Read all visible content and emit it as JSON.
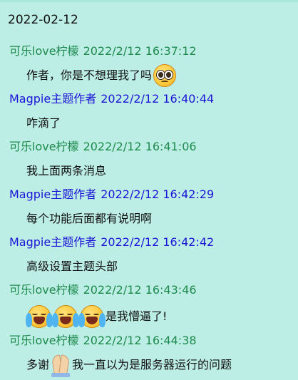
{
  "date_header": "2022-02-12",
  "colors": {
    "background": "#bdeee6",
    "sender_green": "#1d8a4c",
    "sender_blue": "#1b14d6",
    "body_text": "#111111"
  },
  "messages": [
    {
      "sender": "可乐love柠檬",
      "time": "2022/2/12 16:37:12",
      "color": "#1d8a4c",
      "text": "作者，你是不想理我了吗",
      "text_after": "",
      "emoji": "pleading-face-icon"
    },
    {
      "sender": "Magpie主题作者",
      "time": "2022/2/12 16:40:44",
      "color": "#1b14d6",
      "text": "咋滴了",
      "text_after": "",
      "emoji": ""
    },
    {
      "sender": "可乐love柠檬",
      "time": "2022/2/12 16:41:06",
      "color": "#1d8a4c",
      "text": "我上面两条消息",
      "text_after": "",
      "emoji": ""
    },
    {
      "sender": "Magpie主题作者",
      "time": "2022/2/12 16:42:29",
      "color": "#1b14d6",
      "text": "每个功能后面都有说明啊",
      "text_after": "",
      "emoji": ""
    },
    {
      "sender": "Magpie主题作者",
      "time": "2022/2/12 16:42:42",
      "color": "#1b14d6",
      "text": "高级设置主题头部",
      "text_after": "",
      "emoji": ""
    },
    {
      "sender": "可乐love柠檬",
      "time": "2022/2/12 16:43:46",
      "color": "#1d8a4c",
      "text": "",
      "text_after": "是我懵逼了!",
      "emoji": "crying-face-icon x3"
    },
    {
      "sender": "可乐love柠檬",
      "time": "2022/2/12 16:44:38",
      "color": "#1d8a4c",
      "text": "多谢",
      "text_after": "我一直以为是服务器运行的问题",
      "emoji": "folded-hands-icon"
    }
  ]
}
